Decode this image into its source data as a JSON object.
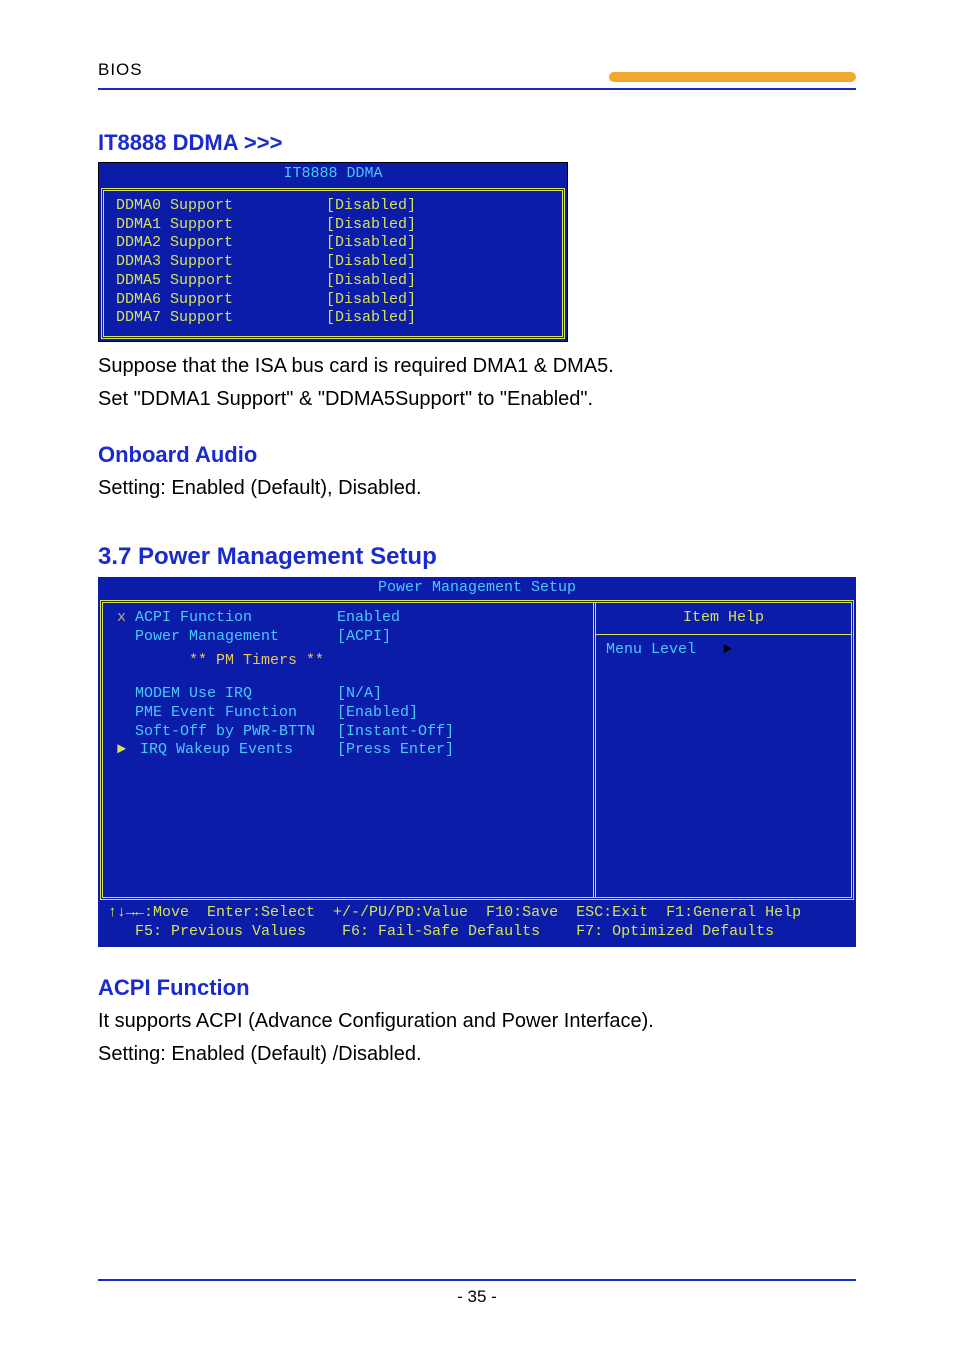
{
  "header": {
    "section_label": "BIOS"
  },
  "ddma_section": {
    "heading": "IT8888 DDMA >>>",
    "bios_title": "IT8888 DDMA",
    "rows": [
      {
        "label": "DDMA0 Support",
        "value": "[Disabled]"
      },
      {
        "label": "DDMA1 Support",
        "value": "[Disabled]"
      },
      {
        "label": "DDMA2 Support",
        "value": "[Disabled]"
      },
      {
        "label": "DDMA3 Support",
        "value": "[Disabled]"
      },
      {
        "label": "DDMA5 Support",
        "value": "[Disabled]"
      },
      {
        "label": "DDMA6 Support",
        "value": "[Disabled]"
      },
      {
        "label": "DDMA7 Support",
        "value": "[Disabled]"
      }
    ],
    "body1": "Suppose that the ISA bus card is required DMA1 & DMA5.",
    "body2": "Set \"DDMA1 Support\" & \"DDMA5Support\" to \"Enabled\"."
  },
  "onboard_audio": {
    "heading": "Onboard Audio",
    "body": "Setting: Enabled (Default), Disabled."
  },
  "power_mgmt": {
    "heading": "3.7 Power Management Setup",
    "bios_title": "Power Management Setup",
    "rows_top": [
      {
        "prefix": "x",
        "label": "ACPI Function",
        "value": "Enabled",
        "dim": true
      },
      {
        "prefix": "",
        "label": "Power Management",
        "value": "[ACPI]"
      }
    ],
    "timers_label": "** PM Timers **",
    "rows_bottom": [
      {
        "prefix": "",
        "label": "MODEM Use IRQ",
        "value": "[N/A]"
      },
      {
        "prefix": "",
        "label": "PME Event Function",
        "value": "[Enabled]"
      },
      {
        "prefix": "",
        "label": "Soft-Off by PWR-BTTN",
        "value": "[Instant-Off]"
      },
      {
        "prefix": "►",
        "label": "IRQ Wakeup Events",
        "value": "[Press Enter]"
      }
    ],
    "help_title": "Item Help",
    "menu_level": "Menu Level",
    "menu_arrow": "►",
    "footer_line1": "↑↓→←:Move  Enter:Select  +/-/PU/PD:Value  F10:Save  ESC:Exit  F1:General Help",
    "footer_line2": "   F5: Previous Values    F6: Fail-Safe Defaults    F7: Optimized Defaults"
  },
  "acpi_function": {
    "heading": "ACPI Function",
    "body1": "It supports ACPI (Advance Configuration and Power Interface).",
    "body2": "Setting: Enabled (Default) /Disabled."
  },
  "page_number": "- 35 -"
}
